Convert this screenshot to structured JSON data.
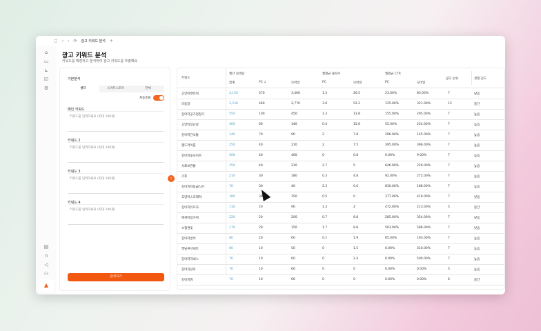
{
  "window": {
    "tab_title": "광고 키워드 분석",
    "new_tab": "+",
    "nav": [
      "‹",
      "›",
      "⟳"
    ]
  },
  "page": {
    "title": "광고 키워드 분석",
    "subtitle": "키워드를 확장하고 분석하여 광고 키워드를 추출해요"
  },
  "sidebar": {
    "icons": [
      "home-icon",
      "briefcase-icon",
      "chart-icon",
      "report-icon",
      "settings-icon"
    ],
    "bottom_icons": [
      "calendar-icon",
      "headset-icon",
      "megaphone-icon",
      "users-icon"
    ]
  },
  "form": {
    "section_label": "기본분석",
    "tabs": [
      {
        "label": "셀프",
        "active": true
      },
      {
        "label": "스마트스토어",
        "active": false
      },
      {
        "label": "전체",
        "active": false
      }
    ],
    "toggle": {
      "label": "자동조회",
      "on": true
    },
    "fields": [
      {
        "label": "메인 키워드",
        "placeholder": "키워드를 입력하세요 (최대 100개)"
      },
      {
        "label": "키워드 2",
        "placeholder": "키워드를 입력하세요 (최대 100개)"
      },
      {
        "label": "키워드 3",
        "placeholder": "키워드를 입력하세요 (최대 100개)"
      },
      {
        "label": "키워드 4",
        "placeholder": "키워드를 입력하세요 (최대 100개)"
      }
    ],
    "submit": "분석하기",
    "accent": "#f2580f"
  },
  "table": {
    "keyword_header": "키워드",
    "groups": [
      {
        "label": "월간 검색량",
        "cols": [
          "합계",
          "PC ↓",
          "모바일"
        ]
      },
      {
        "label": "월평균 클릭수",
        "cols": [
          "PC",
          "모바일"
        ]
      },
      {
        "label": "월평균 CTR",
        "cols": [
          "PC",
          "모바일"
        ]
      }
    ],
    "rank_header": "광고 순위",
    "comp_header": "경쟁 강도",
    "rows": [
      [
        "고양이캣타워",
        "4,150",
        "570",
        "3,460",
        "1.3",
        "26.5",
        "23.00%",
        "83.00%",
        "7",
        "낮음"
      ],
      [
        "이동장",
        "3,230",
        "460",
        "2,770",
        "3.6",
        "52.2",
        "125.00%",
        "321.00%",
        "13",
        "중간"
      ],
      [
        "강아지공기청정기",
        "550",
        "100",
        "450",
        "1.3",
        "13.8",
        "155.00%",
        "295.00%",
        "7",
        "높음"
      ],
      [
        "고양이장난감",
        "400",
        "60",
        "340",
        "0.4",
        "15.6",
        "55.00%",
        "254.00%",
        "7",
        "높음"
      ],
      [
        "강아지간식통",
        "140",
        "70",
        "90",
        "2",
        "7.8",
        "296.00%",
        "145.00%",
        "7",
        "높음"
      ],
      [
        "펫드라이룸",
        "250",
        "40",
        "210",
        "2",
        "7.5",
        "395.00%",
        "396.00%",
        "7",
        "높음"
      ],
      [
        "강아지옷사이즈",
        "500",
        "40",
        "460",
        "0",
        "0.8",
        "0.00%",
        "9.00%",
        "7",
        "높음"
      ],
      [
        "사료보관통",
        "250",
        "40",
        "210",
        "2.7",
        "5",
        "646.00%",
        "226.00%",
        "7",
        "높음"
      ],
      [
        "기후",
        "210",
        "30",
        "180",
        "0.3",
        "4.8",
        "92.00%",
        "272.00%",
        "7",
        "높음"
      ],
      [
        "강아지자동급식기",
        "70",
        "30",
        "40",
        "2.3",
        "0.6",
        "830.00%",
        "188.00%",
        "7",
        "높음"
      ],
      [
        "고양이스크래쳐",
        "180",
        "30",
        "150",
        "0.5",
        "0",
        "377.00%",
        "410.00%",
        "7",
        "낮음"
      ],
      [
        "강아지유모차",
        "110",
        "20",
        "90",
        "1.3",
        "2",
        "472.00%",
        "213.00%",
        "5",
        "중간"
      ],
      [
        "애견미용가위",
        "220",
        "20",
        "200",
        "0.7",
        "8.8",
        "285.00%",
        "354.00%",
        "7",
        "낮음"
      ],
      [
        "소형견옷",
        "170",
        "20",
        "150",
        "1.7",
        "8.8",
        "503.00%",
        "586.00%",
        "7",
        "낮음"
      ],
      [
        "강아지방석",
        "80",
        "20",
        "60",
        "0.1",
        "1.9",
        "85.00%",
        "193.00%",
        "7",
        "높음"
      ],
      [
        "캣닢쿠션세트",
        "60",
        "10",
        "50",
        "0",
        "1.5",
        "0.00%",
        "310.00%",
        "7",
        "높음"
      ],
      [
        "강아지하네스",
        "70",
        "10",
        "60",
        "0",
        "2.4",
        "0.00%",
        "500.00%",
        "7",
        "높음"
      ],
      [
        "강아지샴푸",
        "70",
        "10",
        "60",
        "0",
        "0",
        "0.00%",
        "0.00%",
        "5",
        "높음"
      ],
      [
        "강아지껌",
        "70",
        "10",
        "60",
        "0",
        "0",
        "0.00%",
        "0.00%",
        "6",
        "중간"
      ]
    ]
  }
}
